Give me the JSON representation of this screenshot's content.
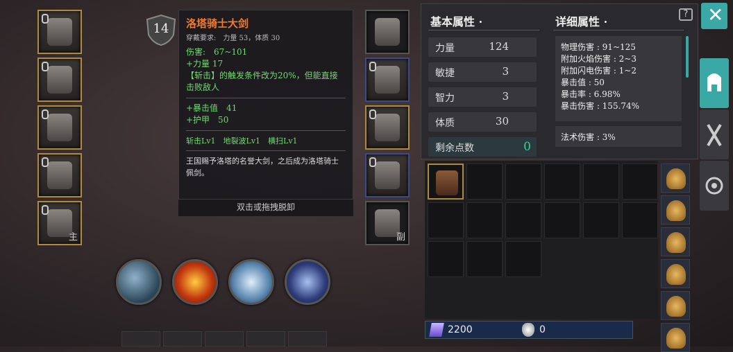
{
  "level": "14",
  "equip_left": [
    {
      "name": "helmet",
      "locked": true,
      "tag": ""
    },
    {
      "name": "chest-armor",
      "locked": true,
      "tag": ""
    },
    {
      "name": "leg-armor",
      "locked": true,
      "tag": ""
    },
    {
      "name": "ring",
      "locked": true,
      "tag": ""
    },
    {
      "name": "main-weapon",
      "locked": true,
      "tag": "主"
    }
  ],
  "equip_right": [
    {
      "name": "necklace",
      "locked": false,
      "tag": ""
    },
    {
      "name": "gloves",
      "locked": true,
      "tag": ""
    },
    {
      "name": "boots",
      "locked": true,
      "tag": ""
    },
    {
      "name": "bracelet",
      "locked": true,
      "tag": ""
    },
    {
      "name": "off-weapon",
      "locked": false,
      "tag": "副"
    }
  ],
  "tooltip": {
    "name": "洛塔骑士大剑",
    "requirement": "穿戴要求:　力量 53，体质 30",
    "damage": "伤害:　67~101",
    "str_bonus": "+力量 17",
    "effect": "【斩击】的触发条件改为20%，但能直接击败敌人",
    "crit_value": "+暴击值　41",
    "armor": "+护甲　50",
    "skills": "斩击Lv1　地裂波Lv1　横扫Lv1",
    "description": "王国赐予洛塔的名誉大剑，之后成为洛塔骑士佩剑。",
    "unequip_hint": "双击或拖拽脱卸"
  },
  "basic_attr": {
    "header": "基本属性 ·",
    "rows": [
      {
        "label": "力量",
        "value": "124"
      },
      {
        "label": "敏捷",
        "value": "3"
      },
      {
        "label": "智力",
        "value": "3"
      },
      {
        "label": "体质",
        "value": "30"
      }
    ],
    "remaining_label": "剩余点数",
    "remaining_value": "0"
  },
  "detail_attr": {
    "header": "详细属性 ·",
    "lines": [
      "物理伤害 : 91~125",
      "附加火焰伤害 : 2~3",
      "附加闪电伤害 : 1~2",
      "暴击值 : 50",
      "暴击率 : 6.98%",
      "暴击伤害 : 155.74%"
    ],
    "magic": "法术伤害 : 3%"
  },
  "currency": {
    "crystal": "2200",
    "gem": "0"
  },
  "colors": {
    "gold": "#b08a3e",
    "green": "#6fdc6f",
    "orange": "#f07a30",
    "teal": "#3aa9a6"
  }
}
